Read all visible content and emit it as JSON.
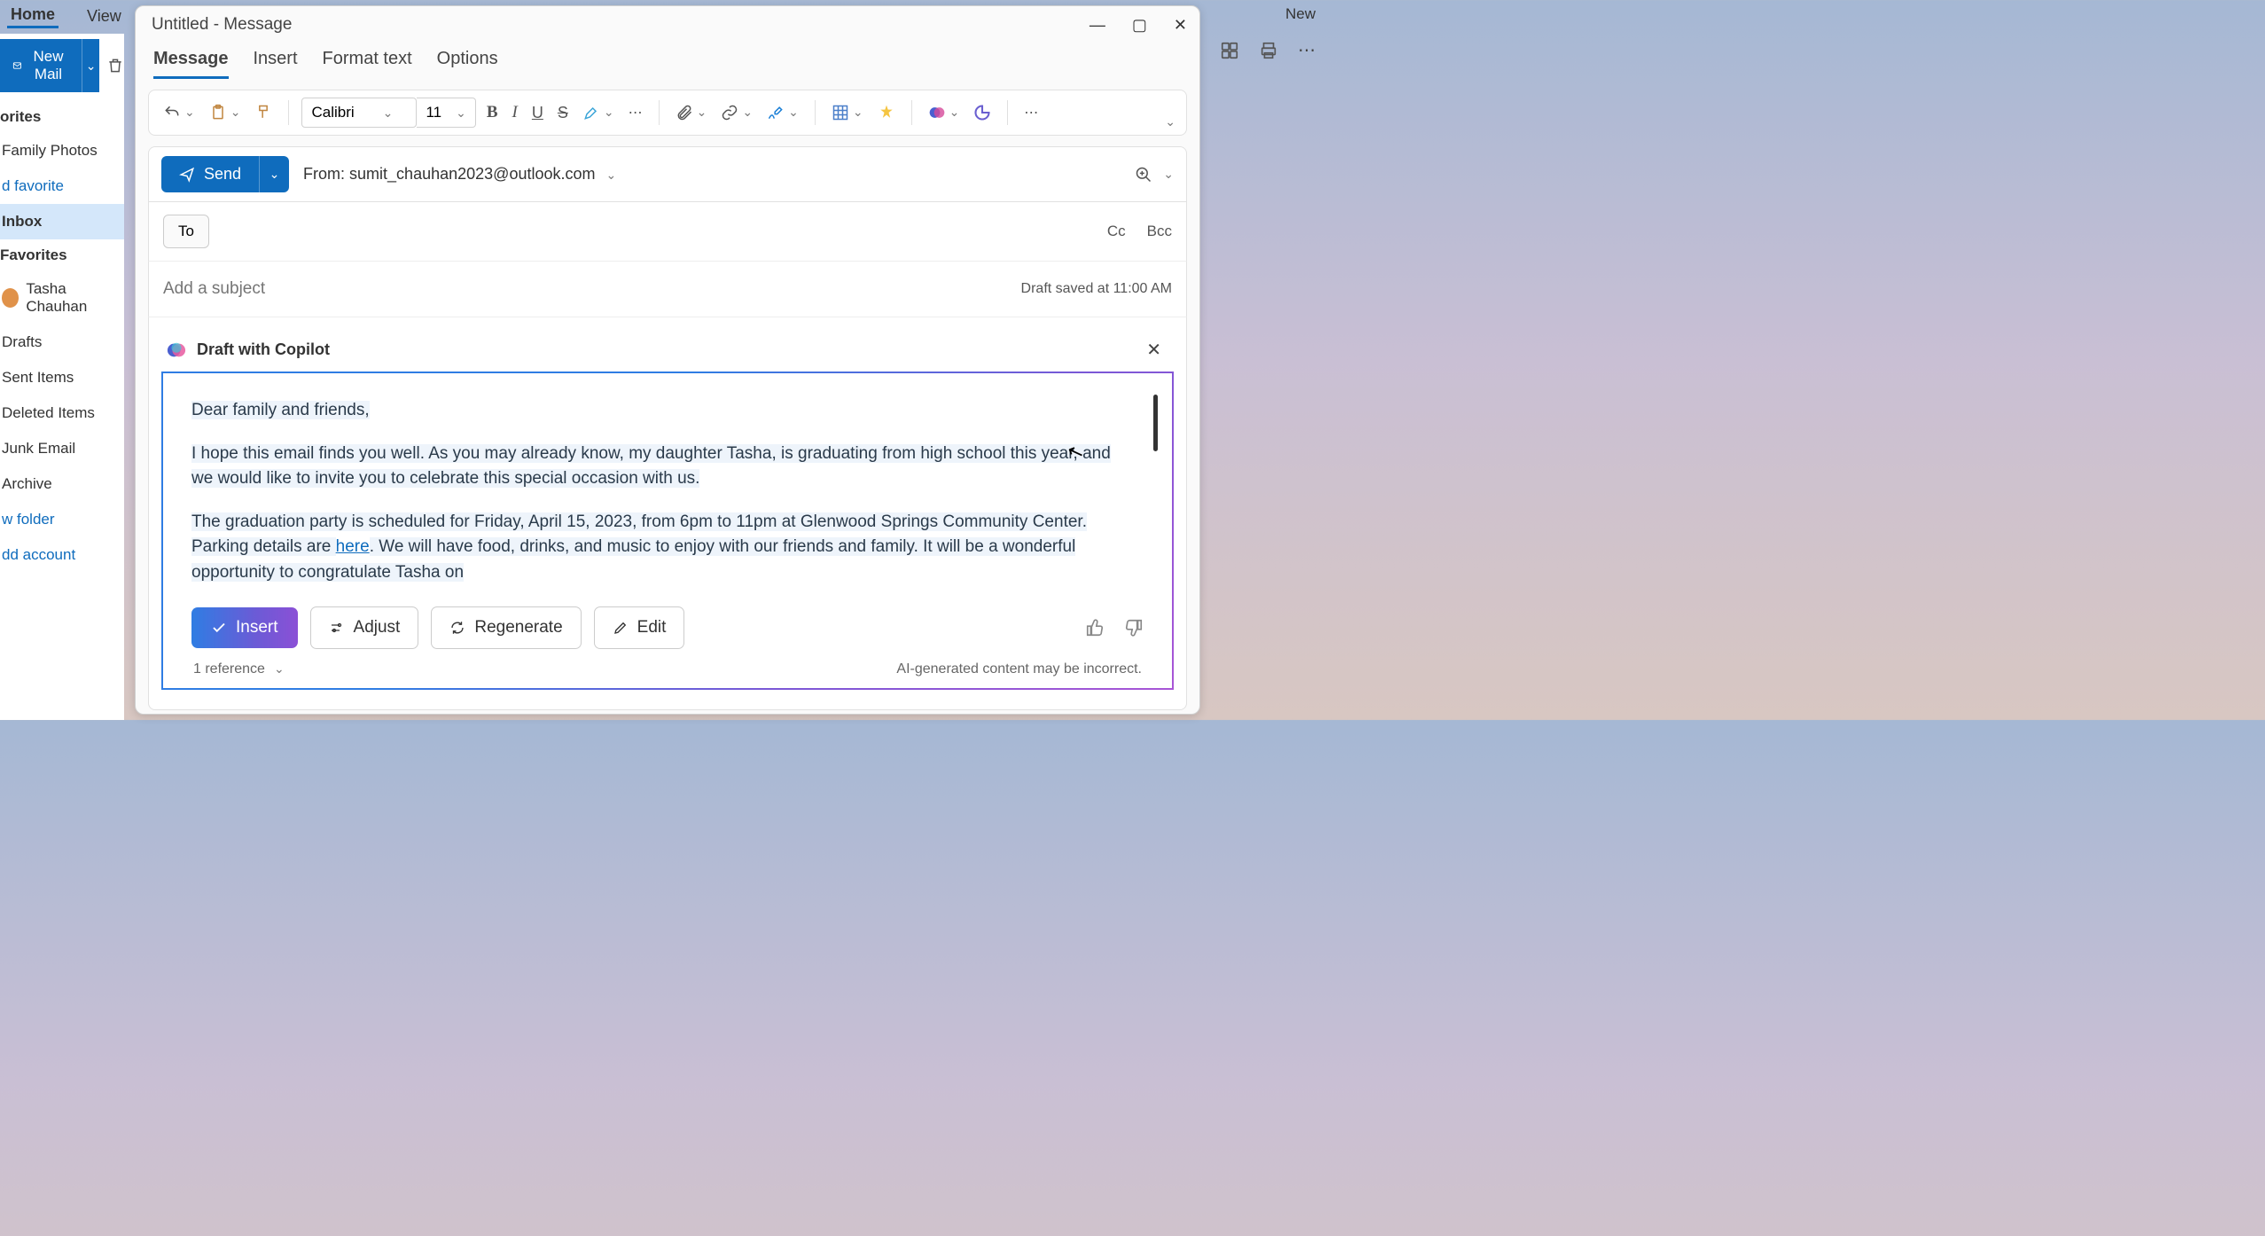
{
  "app_tabs": {
    "home": "Home",
    "view": "View"
  },
  "top_right": {
    "new": "New"
  },
  "sidebar": {
    "new_mail": "New Mail",
    "head_favorites_top": "orites",
    "family_photos": "Family Photos",
    "add_favorite": "d favorite",
    "inbox": "Inbox",
    "favorites": "Favorites",
    "tasha": "Tasha Chauhan",
    "drafts": "Drafts",
    "sent": "Sent Items",
    "deleted": "Deleted Items",
    "junk": "Junk Email",
    "archive": "Archive",
    "new_folder": "w folder",
    "add_account": "dd account"
  },
  "compose": {
    "title": "Untitled - Message",
    "tabs": {
      "message": "Message",
      "insert": "Insert",
      "format": "Format text",
      "options": "Options"
    },
    "font_name": "Calibri",
    "font_size": "11",
    "send": "Send",
    "from_label": "From: sumit_chauhan2023@outlook.com",
    "to": "To",
    "cc": "Cc",
    "bcc": "Bcc",
    "subject_placeholder": "Add a subject",
    "draft_saved": "Draft saved at 11:00 AM"
  },
  "copilot": {
    "title": "Draft with Copilot",
    "p1": "Dear family and friends,",
    "p2": "I hope this email finds you well. As you may already know, my daughter Tasha, is graduating from high school this year, and we would like to invite you to celebrate this special occasion with us.",
    "p3a": "The graduation party is scheduled for Friday, April 15, 2023, from 6pm to 11pm at Glenwood Springs Community Center. Parking details are ",
    "p3_link": "here",
    "p3b": ". We will have food, drinks, and music to enjoy with our friends and family. It will be a wonderful opportunity to congratulate Tasha on",
    "insert": "Insert",
    "adjust": "Adjust",
    "regenerate": "Regenerate",
    "edit": "Edit",
    "reference": "1 reference",
    "disclaimer": "AI-generated content may be incorrect."
  }
}
